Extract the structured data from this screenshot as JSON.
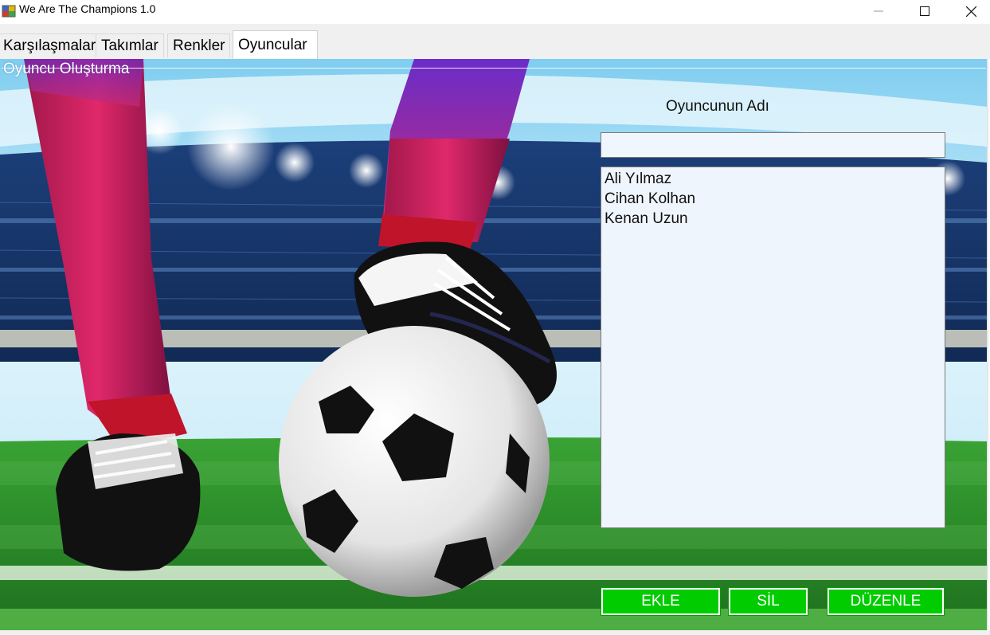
{
  "window": {
    "title": "We Are The Champions 1.0"
  },
  "tabs": [
    {
      "label": "Karşılaşmalar",
      "active": false
    },
    {
      "label": "Takımlar",
      "active": false
    },
    {
      "label": "Renkler",
      "active": false
    },
    {
      "label": "Oyuncular",
      "active": true
    }
  ],
  "groupbox": {
    "title": "Oyuncu Oluşturma"
  },
  "form": {
    "name_label": "Oyuncunun Adı",
    "name_value": "",
    "players": [
      "Ali Yılmaz",
      "Cihan Kolhan",
      "Kenan Uzun"
    ]
  },
  "buttons": {
    "add": "EKLE",
    "delete": "SİL",
    "edit": "DÜZENLE"
  },
  "colors": {
    "button_green": "#00cc00",
    "list_bg": "#eff5fd"
  },
  "icons": [
    "app-icon",
    "minimize-icon",
    "maximize-icon",
    "close-icon"
  ]
}
